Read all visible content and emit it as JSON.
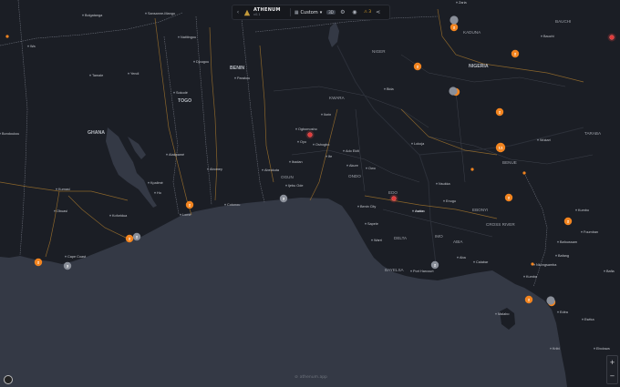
{
  "topbar": {
    "back": "‹",
    "brand": "ATHENUM",
    "brand_sub": "v0.1",
    "mode_label": "Custom",
    "mode_caret": "▾",
    "pill": "3D",
    "alert": "⚠ 3"
  },
  "zoom": {
    "plus": "+",
    "minus": "−"
  },
  "credit": "athenum.app",
  "colors": {
    "land": "#1b1e25",
    "water": "#343945",
    "border": "#6b6f7a",
    "road": "#b07d2d",
    "marker_orange": "#f2841f",
    "marker_gray": "#8a8f99",
    "marker_red": "#e23b3b"
  },
  "labels": [
    {
      "text": "Zaria",
      "cls": "city"
    },
    {
      "text": "BAUCHI",
      "cls": "region"
    },
    {
      "text": "KADUNA",
      "cls": "region"
    },
    {
      "text": "Bauchi",
      "cls": "city"
    },
    {
      "text": "Bolgatanga",
      "cls": "city"
    },
    {
      "text": "Sansanne-Mango",
      "cls": "city"
    },
    {
      "text": "Natitingou",
      "cls": "city"
    },
    {
      "text": "Wa",
      "cls": "city"
    },
    {
      "text": "Djougou",
      "cls": "city"
    },
    {
      "text": "NIGER",
      "cls": "region"
    },
    {
      "text": "NIGERIA",
      "cls": "country"
    },
    {
      "text": "BENIN",
      "cls": "country"
    },
    {
      "text": "Tamale",
      "cls": "city"
    },
    {
      "text": "Yendi",
      "cls": "city"
    },
    {
      "text": "Parakou",
      "cls": "city"
    },
    {
      "text": "Sokodé",
      "cls": "city"
    },
    {
      "text": "TOGO",
      "cls": "country"
    },
    {
      "text": "KWARA",
      "cls": "region"
    },
    {
      "text": "Bida",
      "cls": "city"
    },
    {
      "text": "Ilorin",
      "cls": "city"
    },
    {
      "text": "GHANA",
      "cls": "country"
    },
    {
      "text": "Bondoukou",
      "cls": "city"
    },
    {
      "text": "Ogbomosho",
      "cls": "city"
    },
    {
      "text": "Oyo",
      "cls": "city"
    },
    {
      "text": "Oshogbo",
      "cls": "city"
    },
    {
      "text": "Ado Ekiti",
      "cls": "city"
    },
    {
      "text": "Lokoja",
      "cls": "city"
    },
    {
      "text": "Wukari",
      "cls": "city"
    },
    {
      "text": "TARABA",
      "cls": "region"
    },
    {
      "text": "Atakpamé",
      "cls": "city"
    },
    {
      "text": "Abomey",
      "cls": "city"
    },
    {
      "text": "Ibadan",
      "cls": "city"
    },
    {
      "text": "Ife",
      "cls": "city"
    },
    {
      "text": "Akure",
      "cls": "city"
    },
    {
      "text": "Owo",
      "cls": "city"
    },
    {
      "text": "BENUE",
      "cls": "region"
    },
    {
      "text": "Abeokuta",
      "cls": "city"
    },
    {
      "text": "OGUN",
      "cls": "region"
    },
    {
      "text": "ONDO",
      "cls": "region"
    },
    {
      "text": "Kumasi",
      "cls": "city"
    },
    {
      "text": "Kpalimé",
      "cls": "city"
    },
    {
      "text": "Ho",
      "cls": "city"
    },
    {
      "text": "Ijebu Ode",
      "cls": "city"
    },
    {
      "text": "EDO",
      "cls": "region"
    },
    {
      "text": "Nsukka",
      "cls": "city"
    },
    {
      "text": "Enugu",
      "cls": "city"
    },
    {
      "text": "Obuasi",
      "cls": "city"
    },
    {
      "text": "Koforidua",
      "cls": "city"
    },
    {
      "text": "Lomé",
      "cls": "city"
    },
    {
      "text": "Cotonou",
      "cls": "city"
    },
    {
      "text": "Benin City",
      "cls": "city"
    },
    {
      "text": "Awka",
      "cls": "city"
    },
    {
      "text": "Asaba",
      "cls": "city"
    },
    {
      "text": "EBONYI",
      "cls": "region"
    },
    {
      "text": "Kumbo",
      "cls": "city"
    },
    {
      "text": "CROSS RIVER",
      "cls": "region"
    },
    {
      "text": "Foumban",
      "cls": "city"
    },
    {
      "text": "Sapele",
      "cls": "city"
    },
    {
      "text": "Bafoussam",
      "cls": "city"
    },
    {
      "text": "Warri",
      "cls": "city"
    },
    {
      "text": "DELTA",
      "cls": "region"
    },
    {
      "text": "IMO",
      "cls": "region"
    },
    {
      "text": "ABIA",
      "cls": "region"
    },
    {
      "text": "Bafang",
      "cls": "city"
    },
    {
      "text": "Cape Coast",
      "cls": "city"
    },
    {
      "text": "Aba",
      "cls": "city"
    },
    {
      "text": "Calabar",
      "cls": "city"
    },
    {
      "text": "Nkongsamba",
      "cls": "city"
    },
    {
      "text": "BAYELSA",
      "cls": "region"
    },
    {
      "text": "Port Harcourt",
      "cls": "city"
    },
    {
      "text": "Kumba",
      "cls": "city"
    },
    {
      "text": "Bafia",
      "cls": "city"
    },
    {
      "text": "Malabo",
      "cls": "city"
    },
    {
      "text": "Edéa",
      "cls": "city"
    },
    {
      "text": "Eséka",
      "cls": "city"
    },
    {
      "text": "Kribi",
      "cls": "city"
    },
    {
      "text": "Ebolowa",
      "cls": "city"
    }
  ],
  "markers": [
    {
      "label": "2",
      "color": "orange"
    },
    {
      "label": "",
      "color": "gray_half"
    },
    {
      "label": "",
      "color": "orange_small"
    },
    {
      "label": "",
      "color": "red"
    },
    {
      "label": "2",
      "color": "orange"
    },
    {
      "label": "2",
      "color": "orange"
    },
    {
      "label": "2",
      "color": "orange"
    },
    {
      "label": "",
      "color": "gray_half"
    },
    {
      "label": "2",
      "color": "orange"
    },
    {
      "label": "2",
      "color": "orange"
    },
    {
      "label": "11",
      "color": "orange"
    },
    {
      "label": "",
      "color": "red"
    },
    {
      "label": "2",
      "color": "orange"
    },
    {
      "label": "",
      "color": "red"
    },
    {
      "label": "2",
      "color": "orange"
    },
    {
      "label": "3",
      "color": "gray"
    },
    {
      "label": "2",
      "color": "orange"
    },
    {
      "label": "2",
      "color": "gray"
    },
    {
      "label": "2",
      "color": "orange"
    },
    {
      "label": "3",
      "color": "gray"
    },
    {
      "label": "2",
      "color": "orange"
    },
    {
      "label": "2",
      "color": "gray"
    },
    {
      "label": "2",
      "color": "orange"
    },
    {
      "label": "2",
      "color": "orange"
    },
    {
      "label": "",
      "color": "gray_half"
    },
    {
      "label": "",
      "color": "orange_small"
    },
    {
      "label": "",
      "color": "orange_small"
    },
    {
      "label": "",
      "color": "orange_small"
    }
  ]
}
